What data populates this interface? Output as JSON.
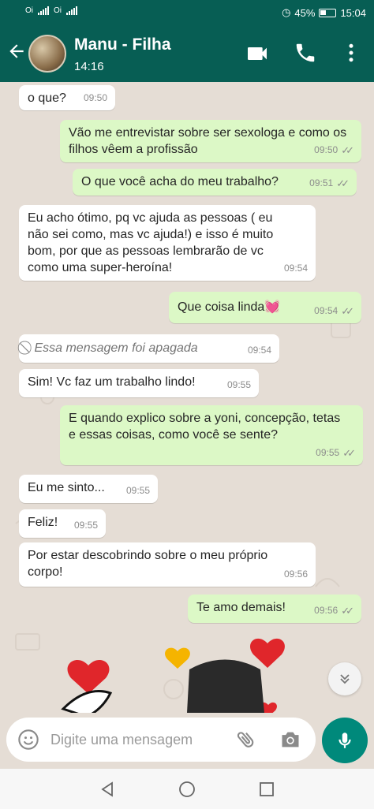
{
  "status_bar": {
    "carrier1": "Oi",
    "carrier2": "Oi",
    "battery": "45%",
    "time": "15:04"
  },
  "header": {
    "name": "Manu - Filha",
    "last_seen": "14:16"
  },
  "messages": [
    {
      "dir": "in",
      "text": "o que?",
      "time": "09:50"
    },
    {
      "dir": "out",
      "text": "Vão me entrevistar sobre ser sexologa e como os filhos vêem a profissão",
      "time": "09:50"
    },
    {
      "dir": "out",
      "text": "O que você acha do meu trabalho?",
      "time": "09:51"
    },
    {
      "dir": "in",
      "text": "Eu acho ótimo, pq vc ajuda as pessoas ( eu não sei como, mas vc ajuda!) e isso é muito bom, por que as pessoas lembrarão de vc como uma super-heroína!",
      "time": "09:54"
    },
    {
      "dir": "out",
      "text": "Que coisa linda💓",
      "time": "09:54"
    },
    {
      "dir": "in",
      "text": "Essa mensagem foi apagada",
      "time": "09:54",
      "deleted": true
    },
    {
      "dir": "in",
      "text": "Sim! Vc faz um trabalho lindo!",
      "time": "09:55"
    },
    {
      "dir": "out",
      "text": "E quando explico sobre a yoni, concepção, tetas e essas coisas, como você se sente?",
      "time": "09:55"
    },
    {
      "dir": "in",
      "text": "Eu me sinto...",
      "time": "09:55"
    },
    {
      "dir": "in",
      "text": "Feliz!",
      "time": "09:55"
    },
    {
      "dir": "in",
      "text": "Por estar descobrindo sobre o meu próprio corpo!",
      "time": "09:56"
    },
    {
      "dir": "out",
      "text": "Te amo demais!",
      "time": "09:56"
    }
  ],
  "input": {
    "placeholder": "Digite uma mensagem"
  },
  "icons": [
    "back-arrow-icon",
    "video-call-icon",
    "phone-icon",
    "more-vert-icon",
    "ban-icon",
    "double-check-icon",
    "chevron-double-down-icon",
    "emoji-icon",
    "paperclip-icon",
    "camera-icon",
    "mic-icon",
    "nav-back-icon",
    "nav-home-icon",
    "nav-recents-icon"
  ],
  "colors": {
    "header": "#075e54",
    "outgoing": "#dcf8c6",
    "incoming": "#ffffff",
    "wallpaper": "#e5ddd5",
    "mic": "#00897b"
  }
}
